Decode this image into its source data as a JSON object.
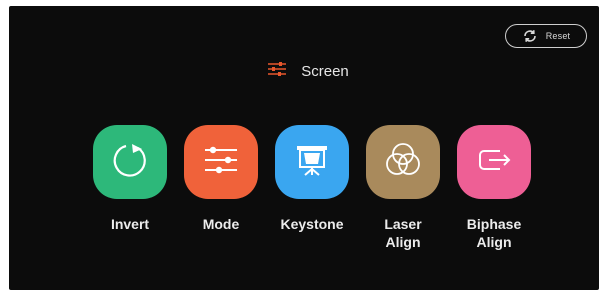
{
  "header": {
    "icon": "sliders-icon",
    "title": "Screen",
    "accent_color": "#e8572d"
  },
  "reset_button": {
    "icon": "rotate-arrows-icon",
    "label": "Reset"
  },
  "tiles": [
    {
      "label": "Invert",
      "icon": "rotate-icon",
      "color": "#2db87a"
    },
    {
      "label": "Mode",
      "icon": "sliders-icon",
      "color": "#f0623a"
    },
    {
      "label": "Keystone",
      "icon": "projection-screen-icon",
      "color": "#3aa6f0"
    },
    {
      "label": "Laser\nAlign",
      "icon": "overlapping-circles-icon",
      "color": "#a98a5c"
    },
    {
      "label": "Biphase\nAlign",
      "icon": "arrow-out-icon",
      "color": "#ee5f95"
    }
  ]
}
